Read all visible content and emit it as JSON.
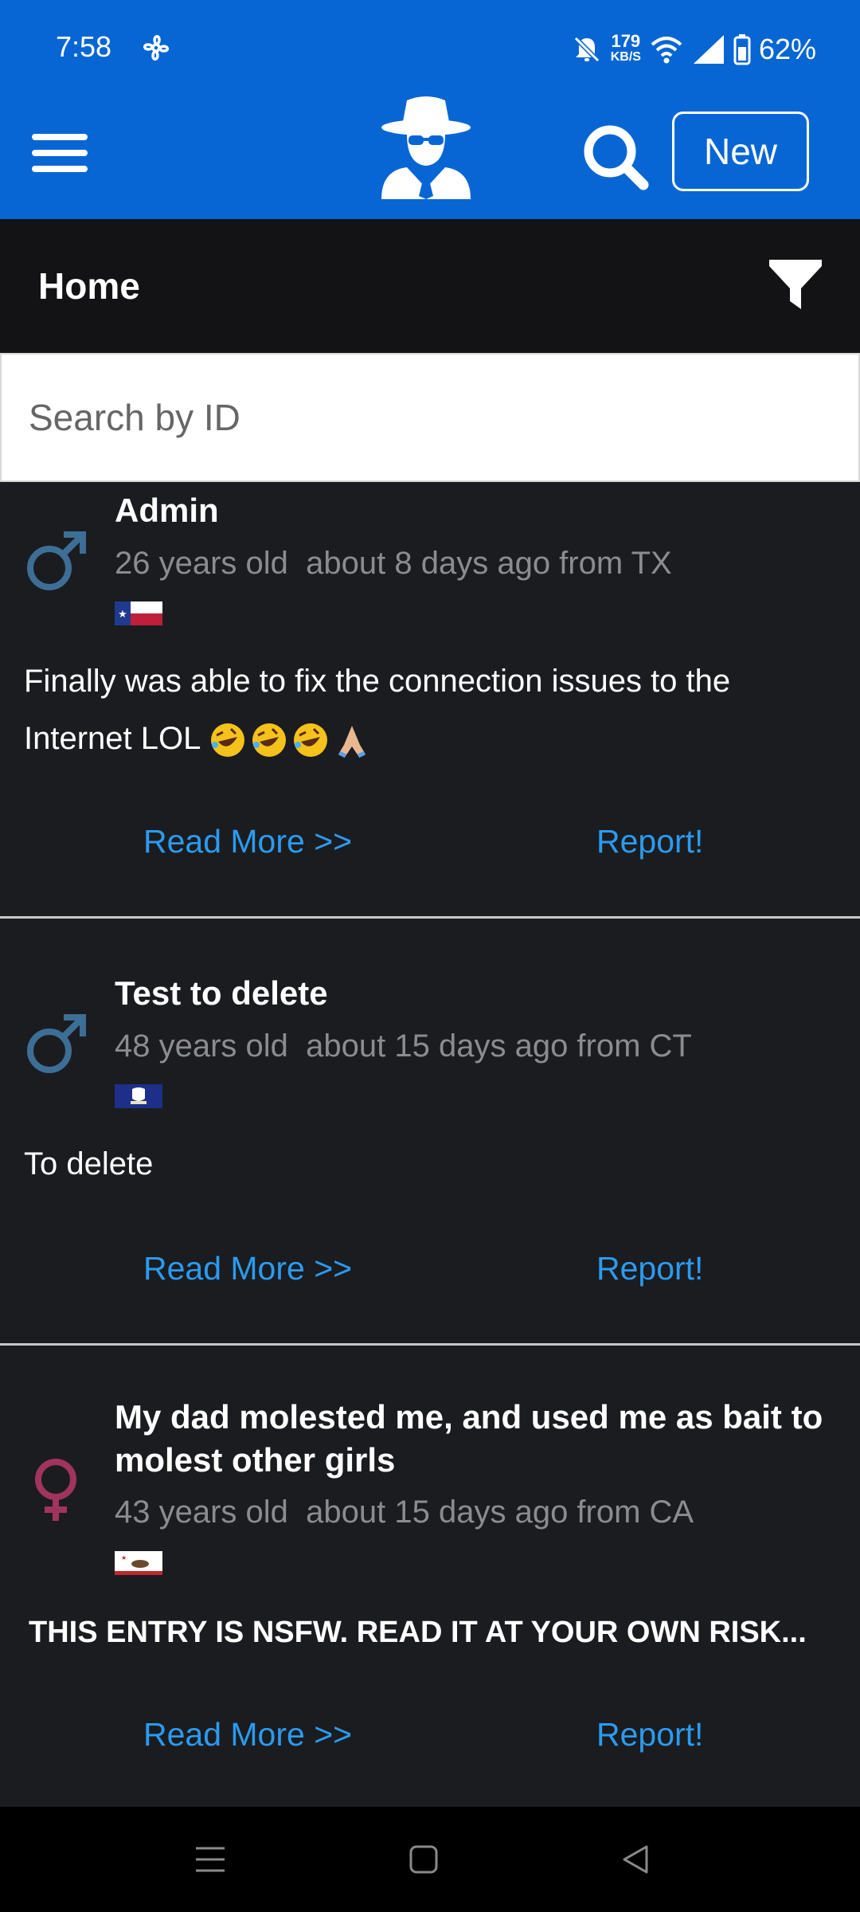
{
  "status_bar": {
    "time": "7:58",
    "net_speed": "179",
    "net_unit": "KB/S",
    "battery": "62%"
  },
  "app_bar": {
    "new_label": "New"
  },
  "home_bar": {
    "title": "Home"
  },
  "search": {
    "placeholder": "Search by ID"
  },
  "posts": [
    {
      "title": "Admin",
      "age": "26 years old",
      "time": "about 8 days ago from TX",
      "body": "Finally was able to fix the connection issues to the Internet LOL",
      "gender": "male",
      "flag": "TX"
    },
    {
      "title": "Test to delete",
      "age": "48 years old",
      "time": "about 15 days ago from CT",
      "body": "To delete",
      "gender": "male",
      "flag": "CT"
    },
    {
      "title": "My dad molested me, and used me as bait to molest other girls",
      "age": "43 years old",
      "time": "about 15 days ago from CA",
      "body": "THIS ENTRY IS NSFW. READ IT AT YOUR OWN RISK...",
      "gender": "female",
      "flag": "CA"
    }
  ],
  "actions": {
    "read_more": "Read More >>",
    "report": "Report!"
  },
  "colors": {
    "brand_blue": "#0866d4",
    "link_blue": "#2b9bf0",
    "male": "#3d6e96",
    "female": "#a0345e"
  }
}
